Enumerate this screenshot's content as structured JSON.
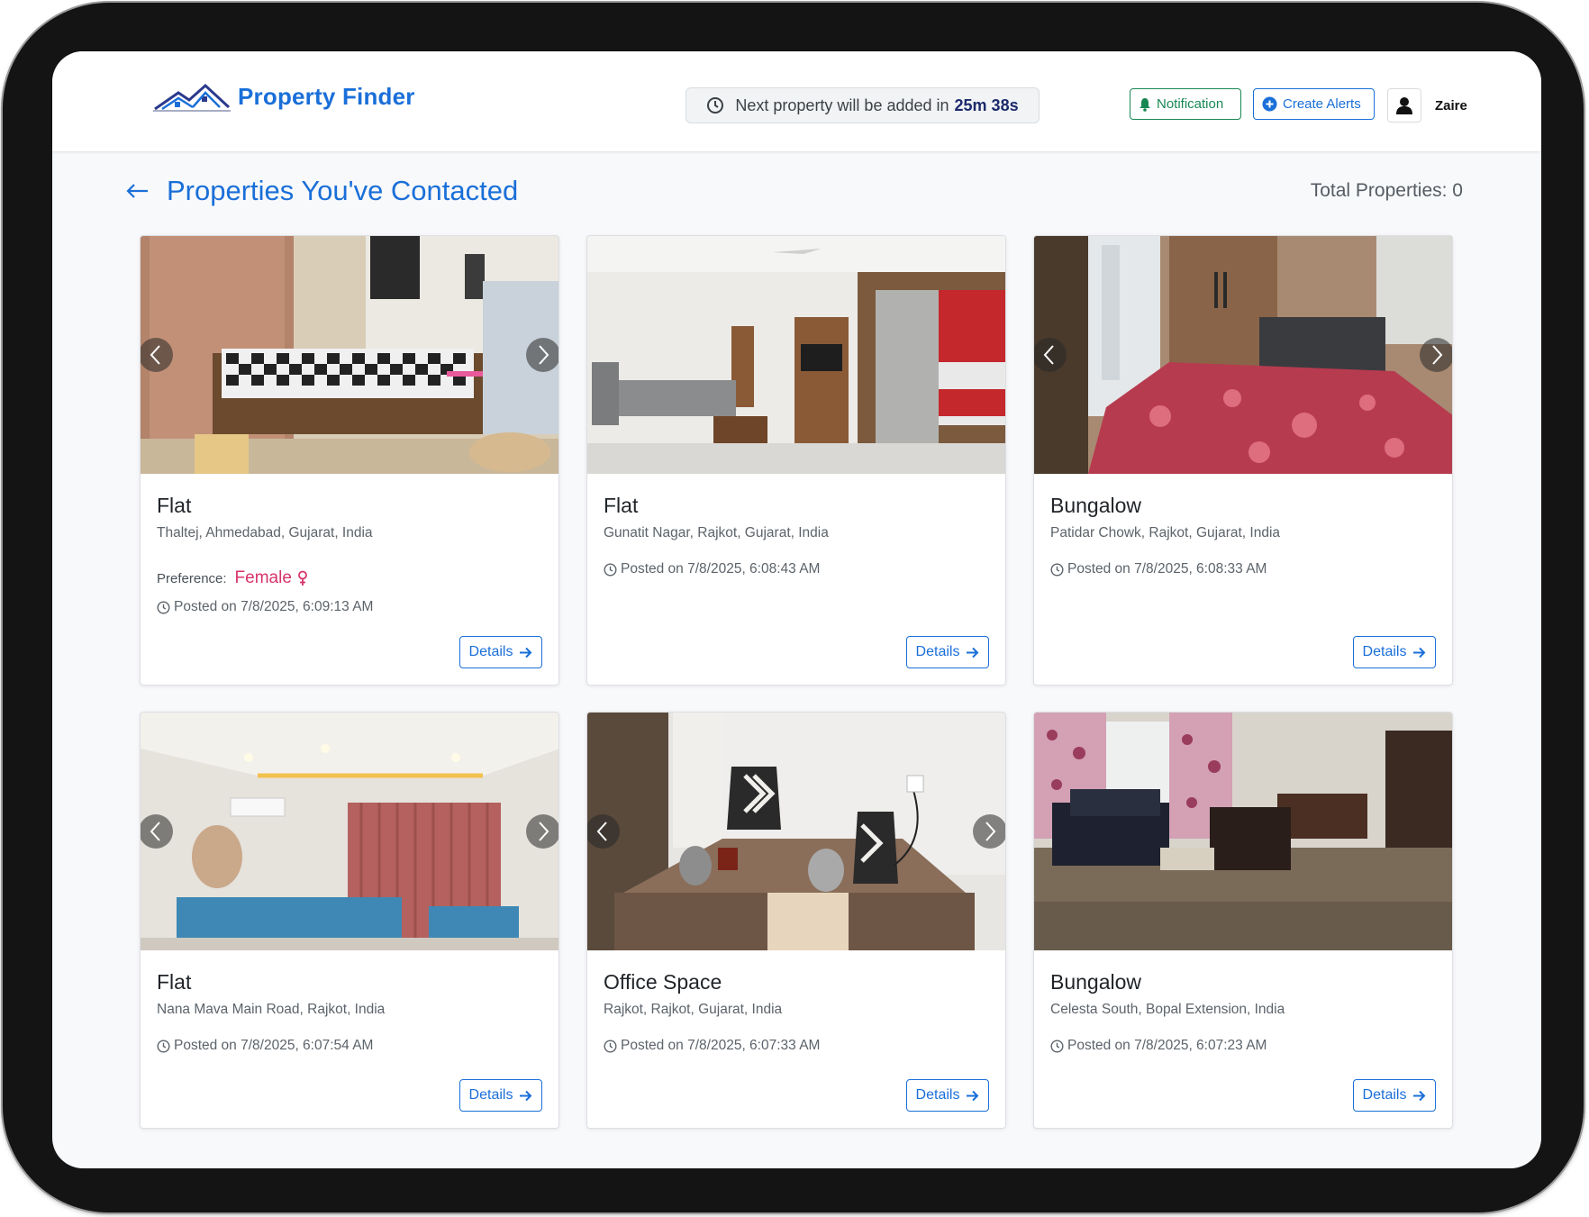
{
  "app": {
    "name": "Property Finder",
    "timer": {
      "prefix": "Next property will be added in",
      "value": "25m 38s"
    },
    "notification_label": "Notification",
    "create_alerts_label": "Create Alerts",
    "user_name": "Zaire"
  },
  "page": {
    "title": "Properties You've Contacted",
    "total": "Total Properties: 0"
  },
  "colors": {
    "primary": "#1a6fd8",
    "success": "#198754",
    "female": "#d6336c"
  },
  "cards": [
    {
      "type": "Flat",
      "location": "Thaltej, Ahmedabad, Gujarat, India",
      "preference_label": "Preference:",
      "preference_value": "Female",
      "preference_icon": "female-icon",
      "posted": "Posted on 7/8/2025, 6:09:13 AM",
      "details_label": "Details",
      "scene": "living-room"
    },
    {
      "type": "Flat",
      "location": "Gunatit Nagar, Rajkot, Gujarat, India",
      "posted": "Posted on 7/8/2025, 6:08:43 AM",
      "details_label": "Details",
      "scene": "living-kitchen"
    },
    {
      "type": "Bungalow",
      "location": "Patidar Chowk, Rajkot, Gujarat, India",
      "posted": "Posted on 7/8/2025, 6:08:33 AM",
      "details_label": "Details",
      "scene": "bedroom"
    },
    {
      "type": "Flat",
      "location": "Nana Mava Main Road, Rajkot, India",
      "posted": "Posted on 7/8/2025, 6:07:54 AM",
      "details_label": "Details",
      "scene": "hall"
    },
    {
      "type": "Office Space",
      "location": "Rajkot, Rajkot, Gujarat, India",
      "posted": "Posted on 7/8/2025, 6:07:33 AM",
      "details_label": "Details",
      "scene": "dining"
    },
    {
      "type": "Bungalow",
      "location": "Celesta South, Bopal Extension, India",
      "posted": "Posted on 7/8/2025, 6:07:23 AM",
      "details_label": "Details",
      "scene": "lounge"
    }
  ]
}
